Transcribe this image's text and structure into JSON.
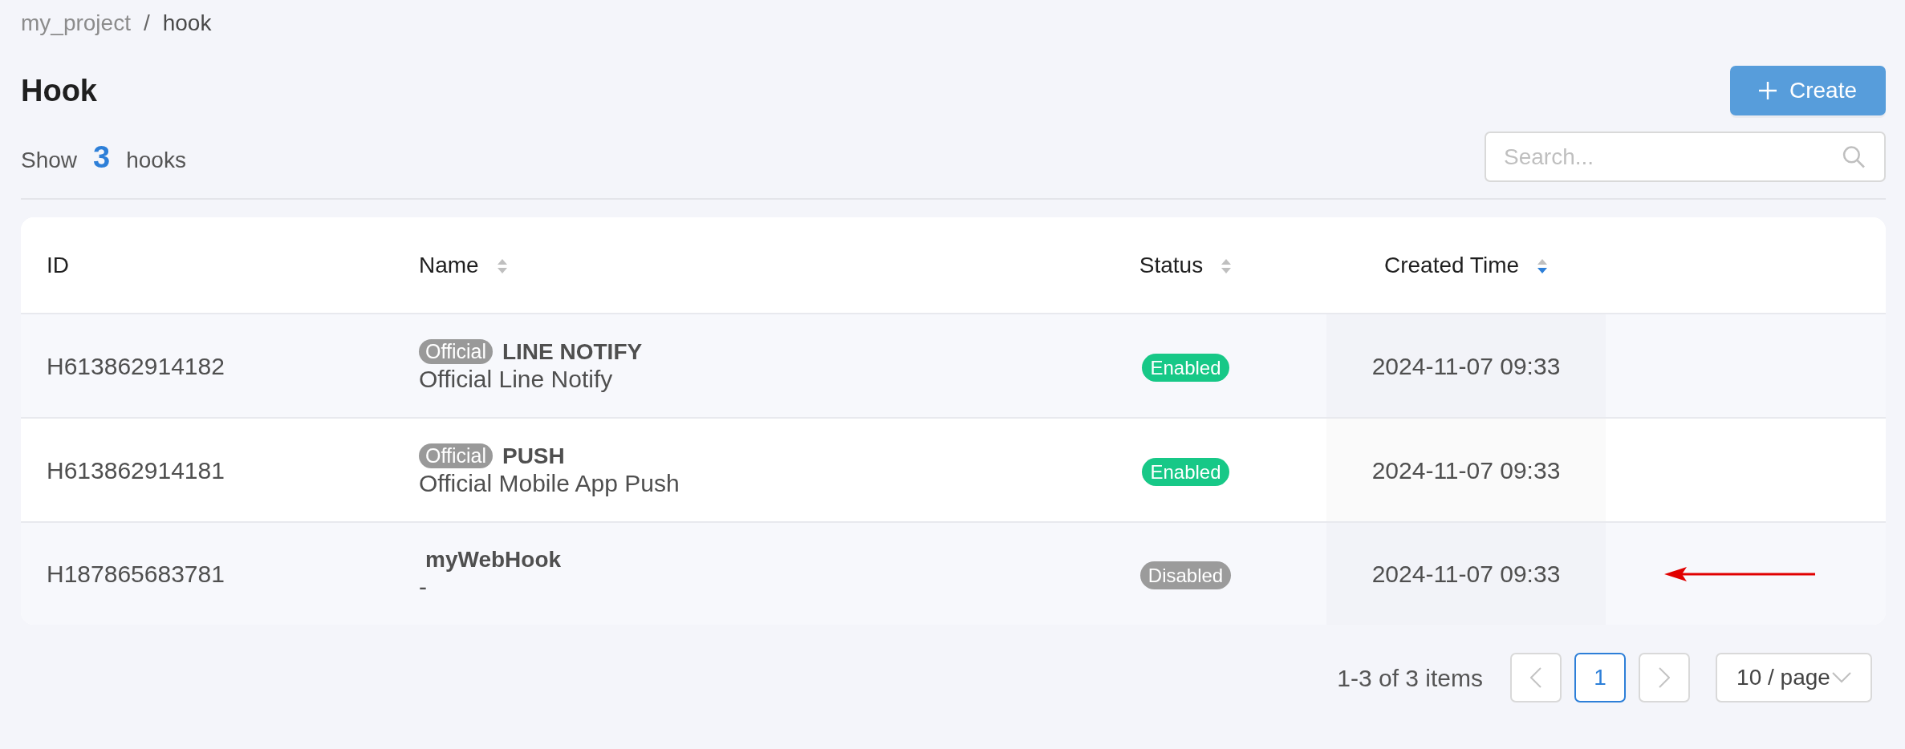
{
  "breadcrumb": {
    "items": [
      {
        "label": "my_project",
        "current": false
      },
      {
        "label": "hook",
        "current": true
      }
    ],
    "separator": "/"
  },
  "title": "Hook",
  "create_button": {
    "label": "Create"
  },
  "summary": {
    "prefix": "Show",
    "count": "3",
    "suffix": "hooks"
  },
  "search": {
    "placeholder": "Search..."
  },
  "table": {
    "columns": [
      {
        "label": "ID",
        "sortable": false
      },
      {
        "label": "Name",
        "sortable": true,
        "sorted": false
      },
      {
        "label": "Status",
        "sortable": true,
        "sorted": false
      },
      {
        "label": "Created Time",
        "sortable": true,
        "sorted": true
      }
    ],
    "rows": [
      {
        "id": "H613862914182",
        "tag": "Official",
        "name": "LINE NOTIFY",
        "description": "Official Line Notify",
        "status": "Enabled",
        "enabled": true,
        "created": "2024-11-07 09:33",
        "annotated": false
      },
      {
        "id": "H613862914181",
        "tag": "Official",
        "name": "PUSH",
        "description": "Official Mobile App Push",
        "status": "Enabled",
        "enabled": true,
        "created": "2024-11-07 09:33",
        "annotated": false
      },
      {
        "id": "H187865683781",
        "name": "myWebHook",
        "description": "-",
        "status": "Disabled",
        "enabled": false,
        "created": "2024-11-07 09:33",
        "annotated": true
      }
    ]
  },
  "pagination": {
    "range": "1-3 of 3 items",
    "prev": {
      "disabled": true
    },
    "pages": [
      {
        "label": "1",
        "selected": true
      }
    ],
    "next": {
      "disabled": true
    },
    "page_size": "10 / page"
  }
}
